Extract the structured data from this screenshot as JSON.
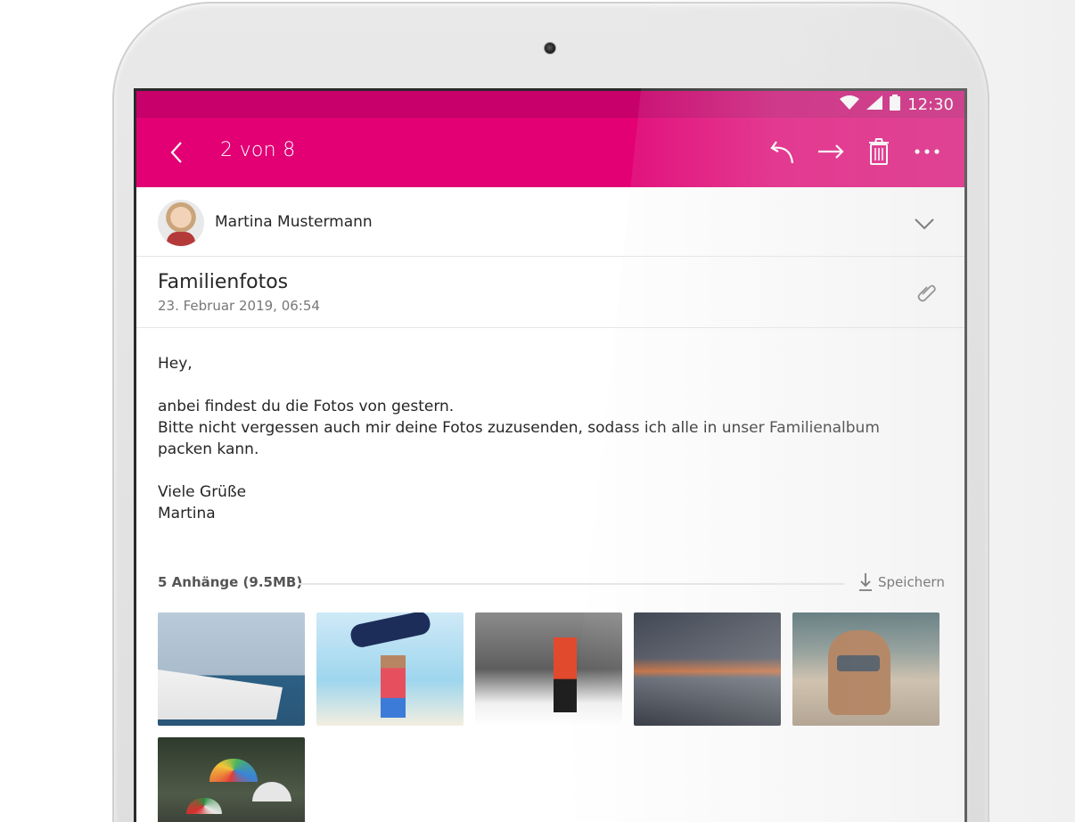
{
  "statusbar": {
    "time": "12:30",
    "icons": [
      "wifi-icon",
      "cellular-signal-icon",
      "battery-icon"
    ],
    "color": "#c8006b"
  },
  "appbar": {
    "title": "2 von 8",
    "color": "#e20074",
    "actions": [
      "reply-icon",
      "forward-icon",
      "trash-icon",
      "more-icon"
    ]
  },
  "sender": {
    "name": "Martina Mustermann"
  },
  "subject": {
    "title": "Familienfotos",
    "date": "23. Februar 2019, 06:54"
  },
  "body": {
    "greeting": "Hey,",
    "line1": "anbei findest du die Fotos von gestern.",
    "line2": "Bitte nicht vergessen auch mir deine Fotos zuzusenden, sodass ich alle in unser Familienalbum packen kann.",
    "closing": "Viele Grüße",
    "signature": "Martina"
  },
  "attachments": {
    "label": "5 Anhänge (9.5MB)",
    "save_label": "Speichern",
    "items": [
      {
        "name": "boat-photo"
      },
      {
        "name": "wakeboard-photo"
      },
      {
        "name": "snow-hiker-photo"
      },
      {
        "name": "sunset-photo"
      },
      {
        "name": "dog-photo"
      },
      {
        "name": "umbrellas-photo"
      }
    ]
  }
}
